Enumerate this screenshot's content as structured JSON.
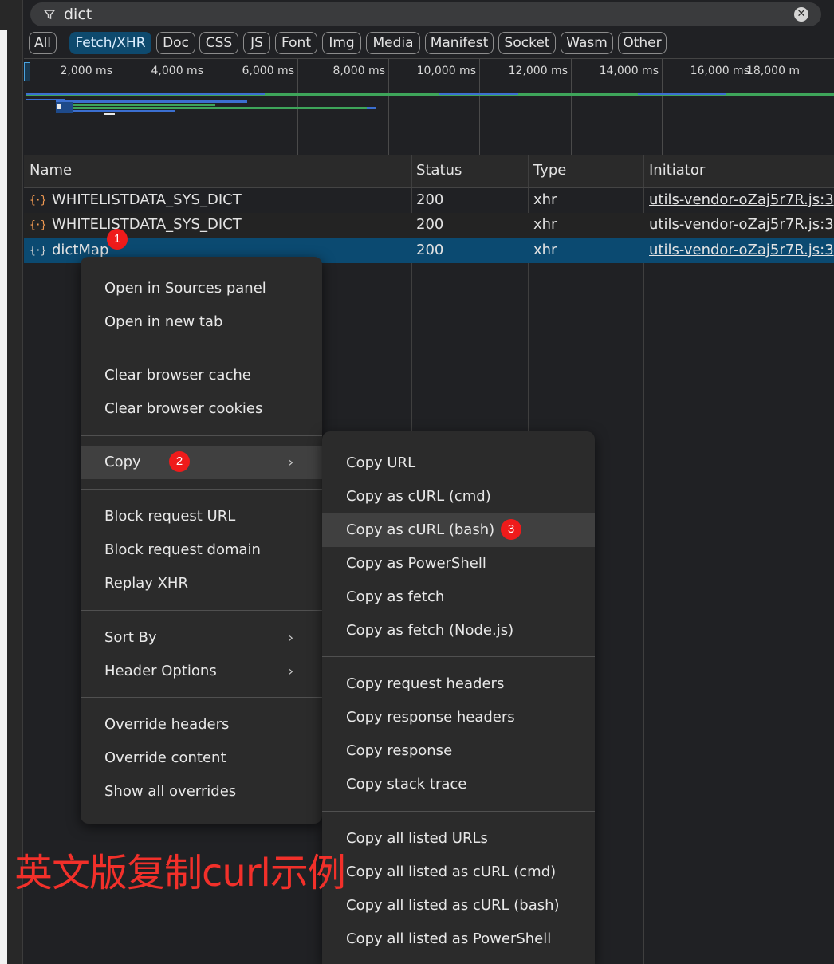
{
  "filter": {
    "value": "dict"
  },
  "chips": [
    "All",
    "Fetch/XHR",
    "Doc",
    "CSS",
    "JS",
    "Font",
    "Img",
    "Media",
    "Manifest",
    "Socket",
    "Wasm",
    "Other"
  ],
  "active_chip": "Fetch/XHR",
  "timeline_ticks": [
    "2,000 ms",
    "4,000 ms",
    "6,000 ms",
    "8,000 ms",
    "10,000 ms",
    "12,000 ms",
    "14,000 ms",
    "16,000 ms",
    "18,000 m"
  ],
  "columns": {
    "name": "Name",
    "status": "Status",
    "type": "Type",
    "initiator": "Initiator"
  },
  "rows": [
    {
      "name": "WHITELISTDATA_SYS_DICT",
      "status": "200",
      "type": "xhr",
      "initiator": "utils-vendor-oZaj5r7R.js:3"
    },
    {
      "name": "WHITELISTDATA_SYS_DICT",
      "status": "200",
      "type": "xhr",
      "initiator": "utils-vendor-oZaj5r7R.js:3"
    },
    {
      "name": "dictMap",
      "status": "200",
      "type": "xhr",
      "initiator": "utils-vendor-oZaj5r7R.js:3"
    }
  ],
  "context_menu": {
    "open_sources": "Open in Sources panel",
    "open_new_tab": "Open in new tab",
    "clear_cache": "Clear browser cache",
    "clear_cookies": "Clear browser cookies",
    "copy": "Copy",
    "block_url": "Block request URL",
    "block_domain": "Block request domain",
    "replay": "Replay XHR",
    "sort_by": "Sort By",
    "header_options": "Header Options",
    "override_headers": "Override headers",
    "override_content": "Override content",
    "show_overrides": "Show all overrides"
  },
  "copy_submenu": {
    "copy_url": "Copy URL",
    "curl_cmd": "Copy as cURL (cmd)",
    "curl_bash": "Copy as cURL (bash)",
    "powershell": "Copy as PowerShell",
    "fetch": "Copy as fetch",
    "fetch_node": "Copy as fetch (Node.js)",
    "req_headers": "Copy request headers",
    "resp_headers": "Copy response headers",
    "response": "Copy response",
    "stack_trace": "Copy stack trace",
    "all_urls": "Copy all listed URLs",
    "all_curl_cmd": "Copy all listed as cURL (cmd)",
    "all_curl_bash": "Copy all listed as cURL (bash)",
    "all_powershell": "Copy all listed as PowerShell"
  },
  "badges": [
    "1",
    "2",
    "3"
  ],
  "annotation": "英文版复制curl示例",
  "colors": {
    "accent": "#0b4a71",
    "badge": "#ef1b1b",
    "annotation": "#f2302a",
    "xhr_icon": "#f29a52"
  }
}
